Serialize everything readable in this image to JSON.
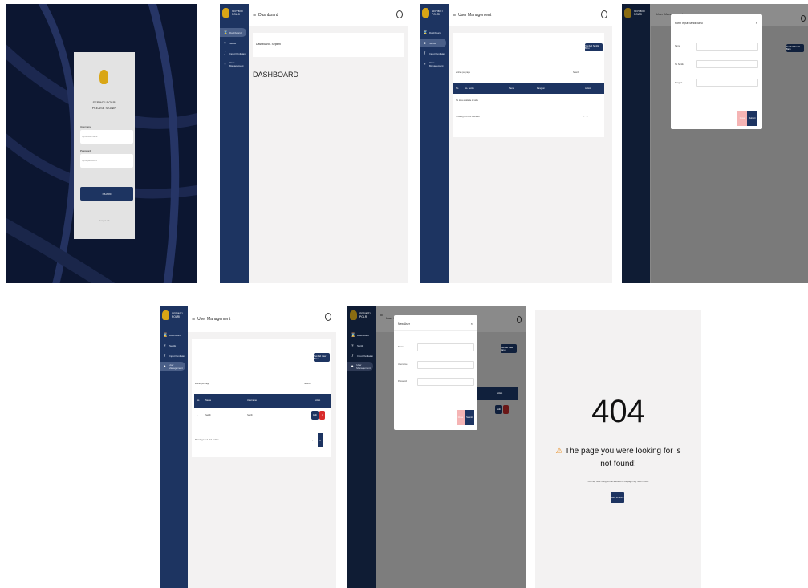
{
  "brand": {
    "line1": "SEPIMTI",
    "line2": "POLRI"
  },
  "nav": {
    "dashboard": "Dashboard",
    "senlik": "Senlik",
    "input": "Input Penilaian",
    "users": "User Management"
  },
  "login": {
    "brand": "SEPIMTI POLRI",
    "prompt": "PLEASE SIGNIN",
    "username_label": "Username",
    "username_ph": "Input username",
    "password_label": "Password",
    "password_ph": "Input password",
    "signin": "SIGNIN",
    "forgot": "Forgot it?"
  },
  "dash": {
    "title": "Dashboard",
    "crumb": "Dashboard - Sepimti",
    "heading": "DASHBOARD"
  },
  "um": {
    "title": "User Management",
    "add_senlik": "Tambah Senlik Baru",
    "add_user": "Tambah User Baru",
    "entries": "entries per page",
    "search": "Search",
    "cols_senlik": [
      "No",
      "No. Senlik",
      "Nama",
      "Pangkat",
      "Action"
    ],
    "no_data": "No data available in table",
    "showing0": "Showing 0 to 0 of 0 entries",
    "cols_user": [
      "No",
      "Nama",
      "Username",
      "Action"
    ],
    "row": {
      "no": "1",
      "nama": "hagith",
      "username": "hagith",
      "edit": "Edit",
      "delete": "×"
    },
    "showing1": "Showing 1 to 1 of 1 entries",
    "page": "1",
    "pg_prev": "‹",
    "pg_next": "›"
  },
  "m1": {
    "title": "Form Input Senlik Baru",
    "f1": "Nama",
    "f2": "No Senlik",
    "f3": "Pangkat",
    "close": "Close",
    "submit": "Submit"
  },
  "m2": {
    "title": "New User",
    "f1": "Nama",
    "f2": "Username",
    "f3": "Password",
    "close": "Close",
    "submit": "Submit"
  },
  "e404": {
    "code": "404",
    "warn": "⚠",
    "msg1": "The page you were looking for is",
    "msg2": "not found!",
    "sub": "You may have mistyped the address or the page may have moved.",
    "btn": "Back to Home"
  },
  "colors": {
    "navy": "#1d3461",
    "gold": "#d9a616",
    "pink": "#f5b4b4",
    "red": "#d92b2b"
  }
}
